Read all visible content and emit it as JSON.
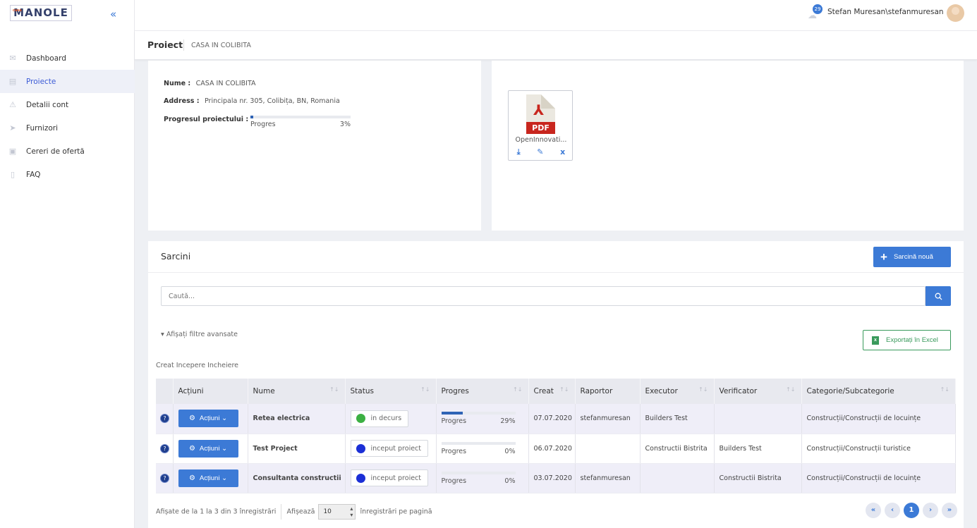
{
  "app": {
    "logo_text": "MANOLE",
    "logo_small": "casa"
  },
  "sidebar": {
    "items": [
      {
        "label": "Dashboard",
        "icon": "envelope-icon",
        "active": false
      },
      {
        "label": "Proiecte",
        "icon": "building-icon",
        "active": true
      },
      {
        "label": "Detalii cont",
        "icon": "warning-icon",
        "active": false
      },
      {
        "label": "Furnizori",
        "icon": "send-icon",
        "active": false
      },
      {
        "label": "Cereri de ofertă",
        "icon": "briefcase-icon",
        "active": false
      },
      {
        "label": "FAQ",
        "icon": "book-icon",
        "active": false
      }
    ]
  },
  "topbar": {
    "notification_count": "29",
    "user_name": "Stefan Muresan\\stefanmuresan"
  },
  "page": {
    "title": "Proiect",
    "subtitle": "CASA IN COLIBITA"
  },
  "project": {
    "name_label": "Nume :",
    "name_value": "CASA IN COLIBITA",
    "address_label": "Address :",
    "address_value": "Principala nr. 305, Colibița, BN, Romania",
    "progress_label": "Progresul proiectului :",
    "progress_text": "Progres",
    "progress_value": "3%",
    "progress_fraction": 0.03
  },
  "files": [
    {
      "name": "OpenInnovati...",
      "type_label": "PDF"
    }
  ],
  "tasks": {
    "title": "Sarcini",
    "new_button": "Sarcină nouă",
    "search_placeholder": "Caută...",
    "filters_toggle": "Afișați filtre avansate",
    "export_button": "Exportați în Excel",
    "filter_chips": "Creat Incepere Incheiere",
    "columns": [
      "Acțiuni",
      "Nume",
      "Status",
      "Progres",
      "Creat",
      "Raportor",
      "Executor",
      "Verificator",
      "Categorie/Subcategorie"
    ],
    "action_label": "Acțiuni",
    "progress_text": "Progres",
    "rows": [
      {
        "name": "Retea electrica",
        "status": "in decurs",
        "status_color": "#3cb043",
        "progress": "29%",
        "progress_fraction": 0.29,
        "created": "07.07.2020",
        "reporter": "stefanmuresan",
        "executor": "Builders Test",
        "verifier": "",
        "category": "Construcții/Construcții de locuințe"
      },
      {
        "name": "Test Project",
        "status": "inceput proiect",
        "status_color": "#1b2fd6",
        "progress": "0%",
        "progress_fraction": 0,
        "created": "06.07.2020",
        "reporter": "",
        "executor": "Constructii Bistrita",
        "verifier": "Builders Test",
        "category": "Construcții/Construcții turistice"
      },
      {
        "name": "Consultanta constructii",
        "status": "inceput proiect",
        "status_color": "#1b2fd6",
        "progress": "0%",
        "progress_fraction": 0,
        "created": "03.07.2020",
        "reporter": "stefanmuresan",
        "executor": "",
        "verifier": "Constructii Bistrita",
        "category": "Construcții/Construcții de locuințe"
      }
    ],
    "footer_info": "Afișate de la 1 la 3 din 3 înregistrări",
    "show_label": "Afișează",
    "page_size": "10",
    "per_page_label": "înregistrări pe pagină",
    "current_page": "1"
  },
  "colors": {
    "accent": "#3c7ad6",
    "excel": "#3a9a5c"
  }
}
